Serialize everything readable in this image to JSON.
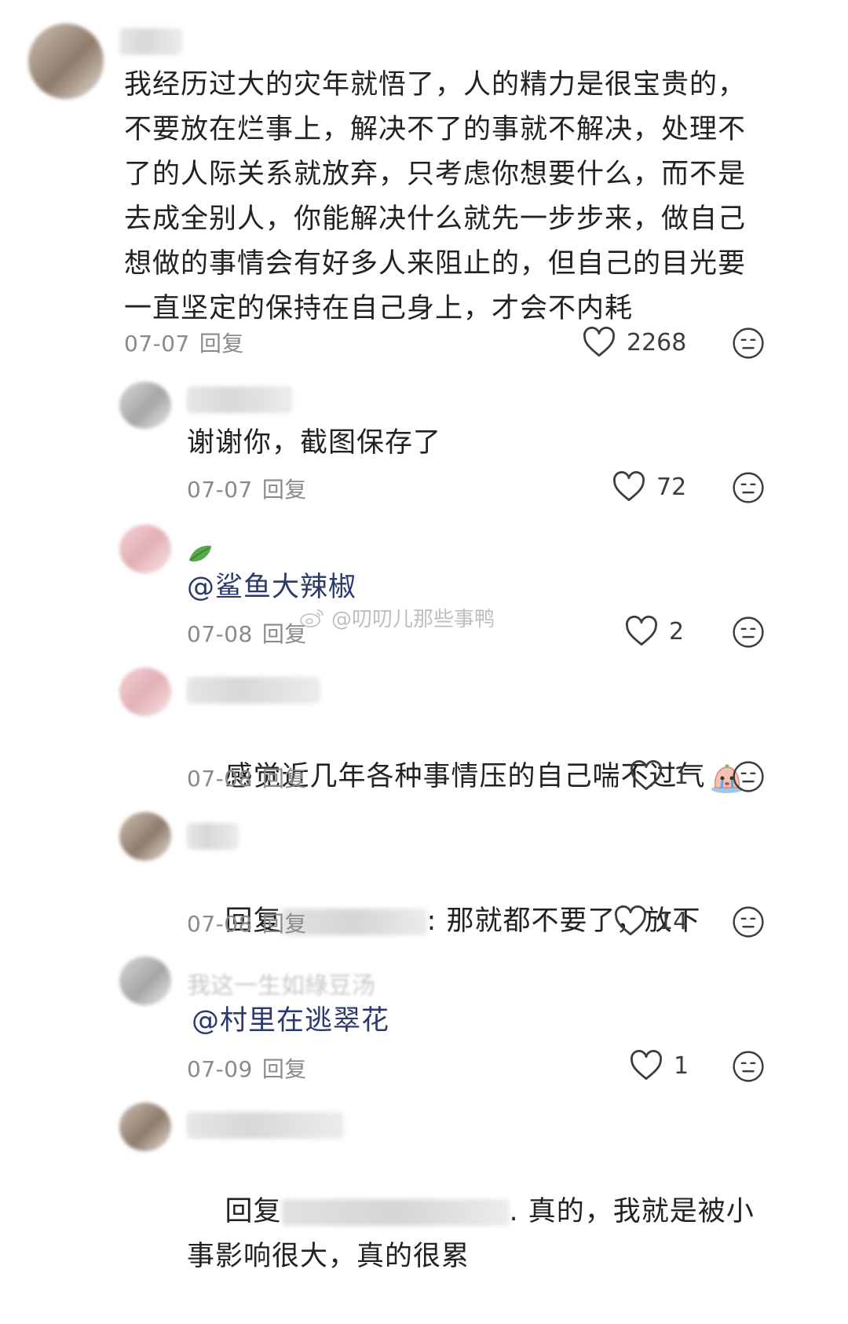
{
  "comments": [
    {
      "text": "我经历过大的灾年就悟了，人的精力是很宝贵的，不要放在烂事上，解决不了的事就不解决，处理不了的人际关系就放弃，只考虑你想要什么，而不是去成全别人，你能解决什么就先一步步来，做自己想做的事情会有好多人来阻止的，但自己的目光要一直坚定的保持在自己身上，才会不内耗",
      "date": "07-07",
      "reply_label": "回复",
      "likes": "2268"
    },
    {
      "text": "谢谢你，截图保存了",
      "date": "07-07",
      "reply_label": "回复",
      "likes": "72"
    },
    {
      "text": "@鲨鱼大辣椒",
      "date": "07-08",
      "reply_label": "回复",
      "likes": "2"
    },
    {
      "text": "感觉近几年各种事情压的自己喘不过气",
      "date": "07-08",
      "reply_label": "回复",
      "likes": "1"
    },
    {
      "text_prefix": "回复",
      "text_suffix": ": 那就都不要了，放下",
      "date": "07-08",
      "reply_label": "回复",
      "likes": "14"
    },
    {
      "faded_name": "我这一生如綠豆汤",
      "text": "@村里在逃翠花",
      "date": "07-09",
      "reply_label": "回复",
      "likes": "1"
    },
    {
      "text_prefix": "回复",
      "text_suffix": ". 真的，我就是被小事影响很大，真的很累"
    }
  ],
  "watermark": "@叨叨儿那些事鸭",
  "icons": {
    "like": "heart-outline-icon",
    "dislike": "meh-face-icon",
    "watermark": "weibo-logo-icon",
    "leaf": "leaf-icon",
    "sticker": "crying-emoji-icon"
  }
}
